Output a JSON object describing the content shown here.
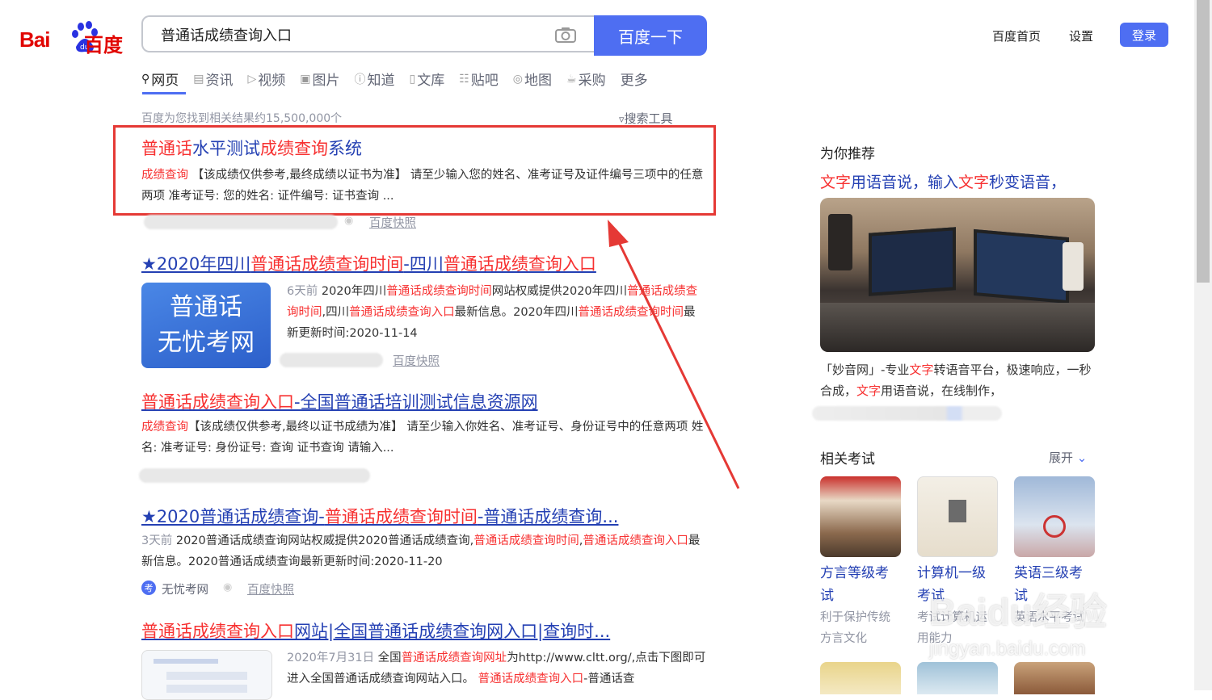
{
  "logo": {
    "text_left": "Bai",
    "text_right": "百度"
  },
  "search": {
    "query": "普通话成绩查询入口",
    "button_label": "百度一下"
  },
  "topnav": {
    "home": "百度首页",
    "settings": "设置",
    "login": "登录"
  },
  "tabs": [
    "网页",
    "资讯",
    "视频",
    "图片",
    "知道",
    "文库",
    "贴吧",
    "地图",
    "采购",
    "更多"
  ],
  "result_count": "百度为您找到相关结果约15,500,000个",
  "search_tools": "搜索工具",
  "results": [
    {
      "title_parts": [
        "普通话",
        "水平测试",
        "成绩查询",
        "系统"
      ],
      "tag": "成绩查询",
      "abstract": "【该成绩仅供参考,最终成绩以证书为准】 请至少输入您的姓名、准考证号及证件编号三项中的任意两项 准考证号: 您的姓名: 证件编号: 证书查询 ...",
      "snapshot": "百度快照"
    },
    {
      "title_parts": [
        "★2020年四川",
        "普通话成绩查询时间",
        "-四川",
        "普通话成绩查询入口"
      ],
      "thumb_line1": "普通话",
      "thumb_line2": "无忧考网",
      "time": "6天前",
      "abstract_parts": [
        " 2020年四川",
        "普通话成绩查询时间",
        "网站权威提供2020年四川",
        "普通话成绩查询时间",
        ",四川",
        "普通话成绩查询入口",
        "最新信息。2020年四川",
        "普通话成绩查询时间",
        "最新更新时间:2020-11-14"
      ],
      "snapshot": "百度快照"
    },
    {
      "title_parts": [
        "普通话成绩查询入口",
        "-全国普通话培训测试信息资源网"
      ],
      "tag": "成绩查询",
      "abstract": "【该成绩仅供参考,最终以证书成绩为准】 请至少输入你姓名、准考证号、身份证号中的任意两项 姓名: 准考证号: 身份证号: 查询 证书查询 请输入..."
    },
    {
      "title_parts": [
        "★2020普通话成绩查询-",
        "普通话成绩查询时间",
        "-普通话成绩查询..."
      ],
      "time": "3天前",
      "abstract_parts": [
        " 2020普通话成绩查询网站权威提供2020普通话成绩查询,",
        "普通话成绩查询时间",
        ",",
        "普通话成绩查询入口",
        "最新信息。2020普通话成绩查询最新更新时间:2020-11-20"
      ],
      "source": "无忧考网",
      "snapshot": "百度快照"
    },
    {
      "title_parts": [
        "普通话成绩查询入口",
        "网站|全国普通话成绩查询网入口|查询时..."
      ],
      "time": "2020年7月31日",
      "abstract_parts": [
        " 全国",
        "普通话成绩查询网址",
        "为http://www.cltt.org/,点击下图即可进入全国普通话成绩查询网站入口。 ",
        "普通话成绩查询入口",
        "-普通话查"
      ]
    }
  ],
  "right": {
    "recommend_title": "为你推荐",
    "ad_title_parts": [
      "文字",
      "用语音说，输入",
      "文字",
      "秒变语音，"
    ],
    "ad_desc_parts": [
      "「妙音网」-专业",
      "文字",
      "转语音平台，极速响应，一秒合成，",
      "文字",
      "用语音说，在线制作，"
    ],
    "related_title": "相关考试",
    "expand": "展开",
    "related": [
      {
        "title": "方言等级考试",
        "sub": "利于保护传统方言文化"
      },
      {
        "title": "计算机一级考试",
        "sub": "考试计算机运用能力"
      },
      {
        "title": "英语三级考试",
        "sub": "英语水平考试"
      }
    ]
  },
  "watermark": {
    "brand": "Baidu经验",
    "url": "jingyan.baidu.com"
  },
  "colors": {
    "brand_blue": "#4e6ef2",
    "title_blue": "#2440b3",
    "highlight_red": "#f73131",
    "annotation_red": "#e53935"
  }
}
